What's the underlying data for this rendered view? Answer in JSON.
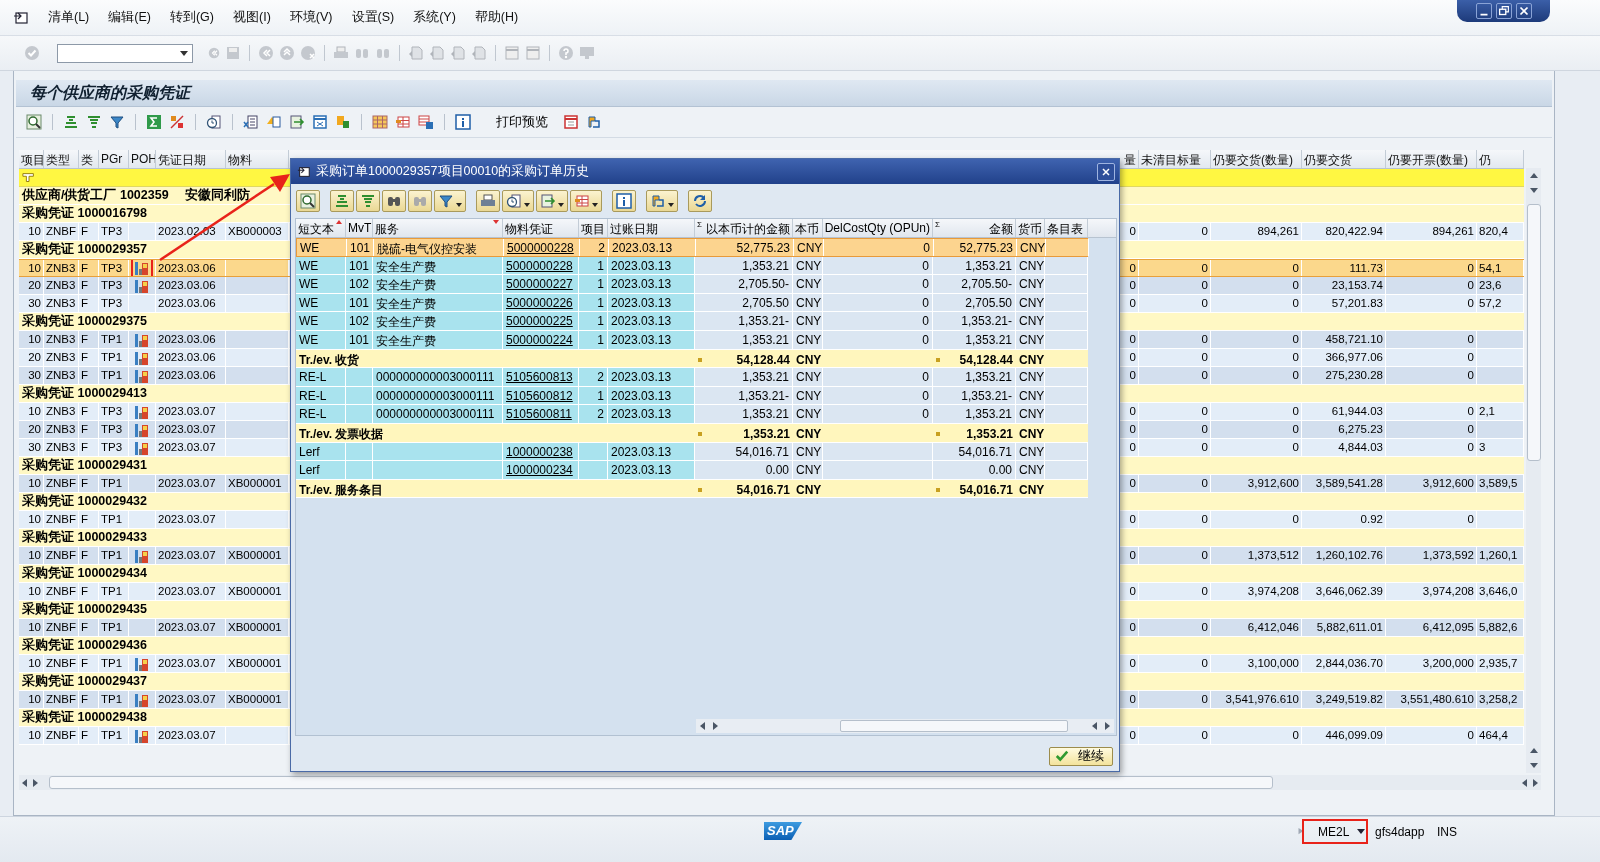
{
  "menu": [
    "清单(L)",
    "编辑(E)",
    "转到(G)",
    "视图(I)",
    "环境(V)",
    "设置(S)",
    "系统(Y)",
    "帮助(H)"
  ],
  "screen_title": "每个供应商的采购凭证",
  "app_toolbar": {
    "print_preview": "打印预览"
  },
  "main_table": {
    "columns": [
      {
        "label": "项目"
      },
      {
        "label": "类型"
      },
      {
        "label": "类"
      },
      {
        "label": "PGr"
      },
      {
        "label": "POH"
      },
      {
        "label": "凭证日期"
      },
      {
        "label": "物料"
      },
      {
        "label": "量"
      },
      {
        "label": "未清目标量"
      },
      {
        "label": "仍要交货(数量)"
      },
      {
        "label": "仍要交货"
      },
      {
        "label": "仍要开票(数量)"
      },
      {
        "label": "仍"
      }
    ],
    "rows": [
      {
        "kind": "filter"
      },
      {
        "kind": "supplier",
        "label": "供应商/供货工厂 1002359",
        "name": "安徽同利防"
      },
      {
        "kind": "group",
        "label": "采购凭证 1000016798"
      },
      {
        "kind": "item",
        "selected": false,
        "poh": false,
        "item": "10",
        "type": "ZNBF",
        "cat": "F",
        "pgr": "TP3",
        "date": "2023.02.03",
        "material": "XB000003",
        "qty": "0",
        "open_target": "0",
        "deliver_qty": "894,261",
        "deliver": "820,422.94",
        "invoice_qty": "894,261",
        "col_13": "820,4"
      },
      {
        "kind": "group",
        "label": "采购凭证 1000029357"
      },
      {
        "kind": "item",
        "selected": true,
        "poh": true,
        "highlighted": true,
        "item": "10",
        "type": "ZNB3",
        "cat": "F",
        "pgr": "TP3",
        "date": "2023.03.06",
        "qty": "0",
        "open_target": "0",
        "deliver_qty": "0",
        "deliver": "111.73",
        "invoice_qty": "0",
        "col_13": "54,1"
      },
      {
        "kind": "item",
        "selected": false,
        "poh": true,
        "item": "20",
        "type": "ZNB3",
        "cat": "F",
        "pgr": "TP3",
        "date": "2023.03.06",
        "qty": "0",
        "open_target": "0",
        "deliver_qty": "0",
        "deliver": "23,153.74",
        "invoice_qty": "0",
        "col_13": "23,6"
      },
      {
        "kind": "item",
        "selected": false,
        "poh": false,
        "item": "30",
        "type": "ZNB3",
        "cat": "F",
        "pgr": "TP3",
        "date": "2023.03.06",
        "qty": "0",
        "open_target": "0",
        "deliver_qty": "0",
        "deliver": "57,201.83",
        "invoice_qty": "0",
        "col_13": "57,2"
      },
      {
        "kind": "group",
        "label": "采购凭证 1000029375"
      },
      {
        "kind": "item",
        "selected": false,
        "poh": true,
        "item": "10",
        "type": "ZNB3",
        "cat": "F",
        "pgr": "TP1",
        "date": "2023.03.06",
        "qty": "0",
        "open_target": "0",
        "deliver_qty": "0",
        "deliver": "458,721.10",
        "invoice_qty": "0"
      },
      {
        "kind": "item",
        "selected": false,
        "poh": true,
        "item": "20",
        "type": "ZNB3",
        "cat": "F",
        "pgr": "TP1",
        "date": "2023.03.06",
        "qty": "0",
        "open_target": "0",
        "deliver_qty": "0",
        "deliver": "366,977.06",
        "invoice_qty": "0"
      },
      {
        "kind": "item",
        "selected": false,
        "poh": true,
        "item": "30",
        "type": "ZNB3",
        "cat": "F",
        "pgr": "TP1",
        "date": "2023.03.06",
        "qty": "0",
        "open_target": "0",
        "deliver_qty": "0",
        "deliver": "275,230.28",
        "invoice_qty": "0"
      },
      {
        "kind": "group",
        "label": "采购凭证 1000029413"
      },
      {
        "kind": "item",
        "selected": false,
        "poh": true,
        "item": "10",
        "type": "ZNB3",
        "cat": "F",
        "pgr": "TP3",
        "date": "2023.03.07",
        "qty": "0",
        "open_target": "0",
        "deliver_qty": "0",
        "deliver": "61,944.03",
        "invoice_qty": "0",
        "col_13": "2,1"
      },
      {
        "kind": "item",
        "selected": false,
        "poh": true,
        "item": "20",
        "type": "ZNB3",
        "cat": "F",
        "pgr": "TP3",
        "date": "2023.03.07",
        "qty": "0",
        "open_target": "0",
        "deliver_qty": "0",
        "deliver": "6,275.23",
        "invoice_qty": "0"
      },
      {
        "kind": "item",
        "selected": false,
        "poh": true,
        "item": "30",
        "type": "ZNB3",
        "cat": "F",
        "pgr": "TP3",
        "date": "2023.03.07",
        "qty": "0",
        "open_target": "0",
        "deliver_qty": "0",
        "deliver": "4,844.03",
        "invoice_qty": "0",
        "col_13": "3"
      },
      {
        "kind": "group",
        "label": "采购凭证 1000029431"
      },
      {
        "kind": "item",
        "selected": false,
        "poh": false,
        "item": "10",
        "type": "ZNBF",
        "cat": "F",
        "pgr": "TP1",
        "date": "2023.03.07",
        "material": "XB000001",
        "qty": "0",
        "open_target": "0",
        "deliver_qty": "3,912,600",
        "deliver": "3,589,541.28",
        "invoice_qty": "3,912,600",
        "col_13": "3,589,5"
      },
      {
        "kind": "group",
        "label": "采购凭证 1000029432"
      },
      {
        "kind": "item",
        "selected": false,
        "poh": false,
        "item": "10",
        "type": "ZNBF",
        "cat": "F",
        "pgr": "TP1",
        "date": "2023.03.07",
        "qty": "0",
        "open_target": "0",
        "deliver_qty": "0",
        "deliver": "0.92",
        "invoice_qty": "0"
      },
      {
        "kind": "group",
        "label": "采购凭证 1000029433"
      },
      {
        "kind": "item",
        "selected": false,
        "poh": true,
        "item": "10",
        "type": "ZNBF",
        "cat": "F",
        "pgr": "TP1",
        "date": "2023.03.07",
        "material": "XB000001",
        "qty": "0",
        "open_target": "0",
        "deliver_qty": "1,373,512",
        "deliver": "1,260,102.76",
        "invoice_qty": "1,373,592",
        "col_13": "1,260,1"
      },
      {
        "kind": "group",
        "label": "采购凭证 1000029434"
      },
      {
        "kind": "item",
        "selected": false,
        "poh": false,
        "item": "10",
        "type": "ZNBF",
        "cat": "F",
        "pgr": "TP1",
        "date": "2023.03.07",
        "material": "XB000001",
        "qty": "0",
        "open_target": "0",
        "deliver_qty": "3,974,208",
        "deliver": "3,646,062.39",
        "invoice_qty": "3,974,208",
        "col_13": "3,646,0"
      },
      {
        "kind": "group",
        "label": "采购凭证 1000029435"
      },
      {
        "kind": "item",
        "selected": false,
        "poh": false,
        "item": "10",
        "type": "ZNBF",
        "cat": "F",
        "pgr": "TP1",
        "date": "2023.03.07",
        "material": "XB000001",
        "qty": "0",
        "open_target": "0",
        "deliver_qty": "6,412,046",
        "deliver": "5,882,611.01",
        "invoice_qty": "6,412,095",
        "col_13": "5,882,6"
      },
      {
        "kind": "group",
        "label": "采购凭证 1000029436"
      },
      {
        "kind": "item",
        "selected": false,
        "poh": true,
        "item": "10",
        "type": "ZNBF",
        "cat": "F",
        "pgr": "TP1",
        "date": "2023.03.07",
        "material": "XB000001",
        "qty": "0",
        "open_target": "0",
        "deliver_qty": "3,100,000",
        "deliver": "2,844,036.70",
        "invoice_qty": "3,200,000",
        "col_13": "2,935,7"
      },
      {
        "kind": "group",
        "label": "采购凭证 1000029437"
      },
      {
        "kind": "item",
        "selected": false,
        "poh": true,
        "item": "10",
        "type": "ZNBF",
        "cat": "F",
        "pgr": "TP1",
        "date": "2023.03.07",
        "material": "XB000001",
        "qty": "0",
        "open_target": "0",
        "deliver_qty": "3,541,976.610",
        "deliver": "3,249,519.82",
        "invoice_qty": "3,551,480.610",
        "col_13": "3,258,2"
      },
      {
        "kind": "group",
        "label": "采购凭证 1000029438"
      },
      {
        "kind": "item",
        "selected": false,
        "poh": true,
        "item": "10",
        "type": "ZNBF",
        "cat": "F",
        "pgr": "TP1",
        "date": "2023.03.07",
        "qty": "0",
        "open_target": "0",
        "deliver_qty": "0",
        "deliver": "446,099.09",
        "invoice_qty": "0",
        "col_13": "464,4"
      }
    ]
  },
  "dialog": {
    "title": "采购订单1000029357项目00010的采购订单历史",
    "columns": [
      {
        "label": "短文本",
        "sort_ascending": true
      },
      {
        "label": "MvT"
      },
      {
        "label": "服务",
        "sort_descending": true
      },
      {
        "label": "物料凭证"
      },
      {
        "label": "项目"
      },
      {
        "label": "过账日期"
      },
      {
        "label": "以本币计的金额",
        "marker": "Σ"
      },
      {
        "label": "本币"
      },
      {
        "label": "DelCostQty (OPUn)"
      },
      {
        "label": "金额",
        "marker": "Σ"
      },
      {
        "label": "货币"
      },
      {
        "label": "条目表"
      }
    ],
    "rows": [
      {
        "kind": "item",
        "selected": true,
        "short_text": "WE",
        "mvt": "101",
        "service": "脱硫-电气仪控安装",
        "doc": "5000000228",
        "item": "2",
        "date": "2023.03.13",
        "amount_local": "52,775.23",
        "local_cur": "CNY",
        "del_cost": "0",
        "amount": "52,775.23",
        "cur": "CNY"
      },
      {
        "kind": "item",
        "selected": false,
        "short_text": "WE",
        "mvt": "101",
        "service": "安全生产费",
        "doc": "5000000228",
        "item": "1",
        "date": "2023.03.13",
        "amount_local": "1,353.21",
        "local_cur": "CNY",
        "del_cost": "0",
        "amount": "1,353.21",
        "cur": "CNY"
      },
      {
        "kind": "item",
        "selected": false,
        "short_text": "WE",
        "mvt": "102",
        "service": "安全生产费",
        "doc": "5000000227",
        "item": "1",
        "date": "2023.03.13",
        "amount_local": "2,705.50-",
        "local_cur": "CNY",
        "del_cost": "0",
        "amount": "2,705.50-",
        "cur": "CNY"
      },
      {
        "kind": "item",
        "selected": false,
        "short_text": "WE",
        "mvt": "101",
        "service": "安全生产费",
        "doc": "5000000226",
        "item": "1",
        "date": "2023.03.13",
        "amount_local": "2,705.50",
        "local_cur": "CNY",
        "del_cost": "0",
        "amount": "2,705.50",
        "cur": "CNY"
      },
      {
        "kind": "item",
        "selected": false,
        "short_text": "WE",
        "mvt": "102",
        "service": "安全生产费",
        "doc": "5000000225",
        "item": "1",
        "date": "2023.03.13",
        "amount_local": "1,353.21-",
        "local_cur": "CNY",
        "del_cost": "0",
        "amount": "1,353.21-",
        "cur": "CNY"
      },
      {
        "kind": "item",
        "selected": false,
        "short_text": "WE",
        "mvt": "101",
        "service": "安全生产费",
        "doc": "5000000224",
        "item": "1",
        "date": "2023.03.13",
        "amount_local": "1,353.21",
        "local_cur": "CNY",
        "del_cost": "0",
        "amount": "1,353.21",
        "cur": "CNY"
      },
      {
        "kind": "total",
        "label": "Tr./ev. 收货",
        "amount_local": "54,128.44",
        "local_cur": "CNY",
        "amount": "54,128.44",
        "cur": "CNY"
      },
      {
        "kind": "item",
        "selected": false,
        "short_text": "RE-L",
        "service": "000000000003000111",
        "doc": "5105600813",
        "item": "2",
        "date": "2023.03.13",
        "amount_local": "1,353.21",
        "local_cur": "CNY",
        "del_cost": "0",
        "amount": "1,353.21",
        "cur": "CNY"
      },
      {
        "kind": "item",
        "selected": false,
        "short_text": "RE-L",
        "service": "000000000003000111",
        "doc": "5105600812",
        "item": "1",
        "date": "2023.03.13",
        "amount_local": "1,353.21-",
        "local_cur": "CNY",
        "del_cost": "0",
        "amount": "1,353.21-",
        "cur": "CNY"
      },
      {
        "kind": "item",
        "selected": false,
        "short_text": "RE-L",
        "service": "000000000003000111",
        "doc": "5105600811",
        "item": "2",
        "date": "2023.03.13",
        "amount_local": "1,353.21",
        "local_cur": "CNY",
        "del_cost": "0",
        "amount": "1,353.21",
        "cur": "CNY"
      },
      {
        "kind": "total",
        "label": "Tr./ev. 发票收据",
        "amount_local": "1,353.21",
        "local_cur": "CNY",
        "amount": "1,353.21",
        "cur": "CNY"
      },
      {
        "kind": "item",
        "selected": false,
        "short_text": "Lerf",
        "doc": "1000000238",
        "date": "2023.03.13",
        "amount_local": "54,016.71",
        "local_cur": "CNY",
        "amount": "54,016.71",
        "cur": "CNY"
      },
      {
        "kind": "item",
        "selected": false,
        "short_text": "Lerf",
        "doc": "1000000234",
        "date": "2023.03.13",
        "amount_local": "0.00",
        "local_cur": "CNY",
        "amount": "0.00",
        "cur": "CNY"
      },
      {
        "kind": "total",
        "label": "Tr./ev. 服务条目",
        "amount_local": "54,016.71",
        "local_cur": "CNY",
        "amount": "54,016.71",
        "cur": "CNY"
      }
    ],
    "button": "继续"
  },
  "status_bar": {
    "logo": "SAP",
    "transaction": "ME2L",
    "transaction_highlighted": true,
    "system": "gfs4dapp",
    "mode": "INS"
  }
}
